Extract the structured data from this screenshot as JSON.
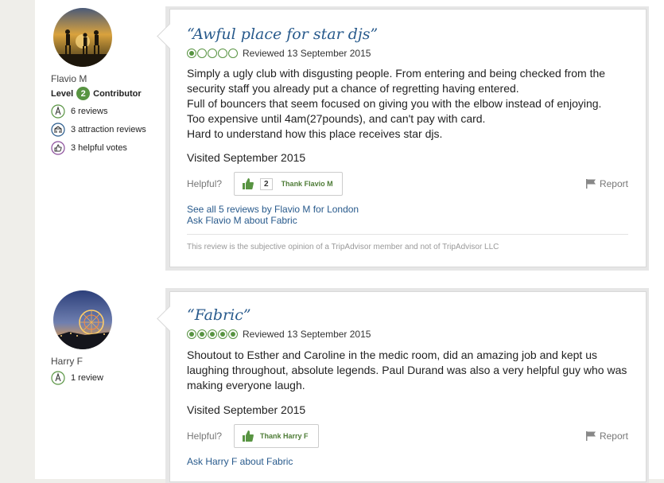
{
  "reviews": [
    {
      "user": {
        "name": "Flavio M",
        "level_prefix": "Level",
        "level_number": "2",
        "level_suffix": "Contributor",
        "stats": [
          {
            "icon": "pen-icon",
            "text": "6 reviews"
          },
          {
            "icon": "attraction-icon",
            "text": "3 attraction reviews"
          },
          {
            "icon": "thumbs-up-icon",
            "text": "3 helpful votes"
          }
        ]
      },
      "title": "“Awful place for star djs”",
      "rating": 1,
      "reviewed_date": "Reviewed 13 September 2015",
      "body": [
        "Simply a ugly club with disgusting people. From entering and being checked from the security staff you already put a chance of regretting having entered.",
        "Full of bouncers that seem focused on giving you with the elbow instead of enjoying.",
        "Too expensive until 4am(27pounds), and can't pay with card.",
        "Hard to understand how this place receives star djs."
      ],
      "visited": "Visited September 2015",
      "helpful_label": "Helpful?",
      "helpful_count": "2",
      "thank_label": "Thank Flavio M",
      "report_label": "Report",
      "links": [
        "See all 5 reviews by Flavio M for London",
        "Ask Flavio M about Fabric"
      ],
      "disclaimer": "This review is the subjective opinion of a TripAdvisor member and not of TripAdvisor LLC"
    },
    {
      "user": {
        "name": "Harry F",
        "stats": [
          {
            "icon": "pen-icon",
            "text": "1 review"
          }
        ]
      },
      "title": "“Fabric”",
      "rating": 5,
      "reviewed_date": "Reviewed 13 September 2015",
      "body": [
        "Shoutout to Esther and Caroline in the medic room, did an amazing job and kept us laughing throughout, absolute legends. Paul Durand was also a very helpful guy who was making everyone laugh."
      ],
      "visited": "Visited September 2015",
      "helpful_label": "Helpful?",
      "thank_label": "Thank Harry F",
      "report_label": "Report",
      "links": [
        "Ask Harry F about Fabric"
      ]
    }
  ],
  "colors": {
    "accent_green": "#589442",
    "link_blue": "#285a8c",
    "page_bg": "#efeeea"
  }
}
